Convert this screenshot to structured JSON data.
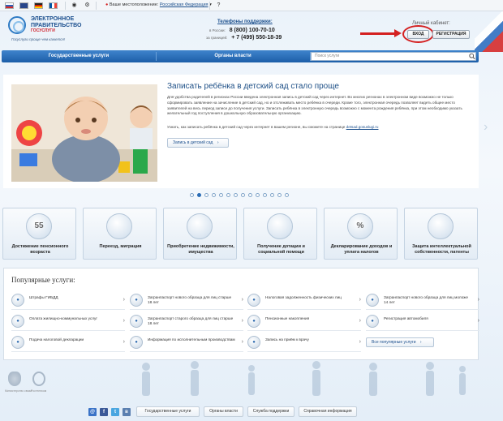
{
  "location": {
    "label": "Ваше местоположение:",
    "city": "Российская Федерация"
  },
  "logo": {
    "line1": "ЭЛЕКТРОННОЕ",
    "line2": "ПРАВИТЕЛЬСТВО",
    "line3": "ГОСУСЛУГИ",
    "slogan": "Госуслуги проще чем кажется!"
  },
  "support": {
    "title": "Телефоны поддержки:",
    "rows": [
      {
        "label": "в России:",
        "number": "8 (800) 100-70-10"
      },
      {
        "label": "за границей:",
        "number": "+ 7 (499) 550-18-39"
      }
    ]
  },
  "cabinet": {
    "title": "Личный кабинет:",
    "login": "ВХОД",
    "register": "РЕГИСТРАЦИЯ"
  },
  "nav": {
    "items": [
      "Государственные услуги",
      "Органы власти"
    ],
    "search_placeholder": "Поиск услуги"
  },
  "banner": {
    "title": "Записать ребёнка в детский сад стало проще",
    "text": "Для удобства родителей в регионах России введена электронная запись в детский сад через интернет. Во многих регионах в электронном виде возможно не только сформировать заявление на зачисление в детский сад, но и отслеживать место ребёнка в очереди. Кроме того, электронная очередь позволяет видеть общее место заявителей на весь период записи до получения услуги. Записать ребёнка в электронную очередь возможно с момента рождения ребёнка, при этом необходимо указать желательный год поступления в дошкольную образовательную организацию.",
    "text2": "Узнать, как записать ребёнка в детский сад через интернет в вашем регионе, вы сможете на странице",
    "link": "detsad.gosuslugi.ru",
    "button": "Запись в детский сад"
  },
  "slider": {
    "count": 14,
    "active": 1
  },
  "tiles": [
    {
      "icon_text": "55",
      "icon": "pension-icon",
      "label": "Достижение пенсионного возраста"
    },
    {
      "icon_text": "",
      "icon": "passport-icon",
      "label": "Переезд, миграция"
    },
    {
      "icon_text": "",
      "icon": "house-icon",
      "label": "Приобретение недвижимости, имущества"
    },
    {
      "icon_text": "",
      "icon": "lifebuoy-icon",
      "label": "Получение дотации и социальной помощи"
    },
    {
      "icon_text": "%",
      "icon": "percent-icon",
      "label": "Декларирование доходов и уплата налогов"
    },
    {
      "icon_text": "",
      "icon": "certificate-icon",
      "label": "Защита интеллектуальной собственности, патенты"
    }
  ],
  "popular": {
    "title": "Популярные услуги:",
    "items": [
      {
        "label": "Штрафы ГИБДД",
        "icon": "traffic-light-icon"
      },
      {
        "label": "Загранпаспорт нового образца для лиц старше 18 лет",
        "icon": "passport-icon"
      },
      {
        "label": "Налоговая задолженность физических лиц",
        "icon": "tax-icon"
      },
      {
        "label": "Загранпаспорт нового образца для лиц моложе 14 лет",
        "icon": "passport-child-icon"
      },
      {
        "label": "Оплата жилищно-коммунальных услуг",
        "icon": "utilities-icon"
      },
      {
        "label": "Загранпаспорт старого образца для лиц старше 18 лет",
        "icon": "passport-old-icon"
      },
      {
        "label": "Пенсионные накопления",
        "icon": "pension-savings-icon"
      },
      {
        "label": "Регистрация автомобиля",
        "icon": "car-icon"
      },
      {
        "label": "Подача налоговой декларации",
        "icon": "declaration-icon"
      },
      {
        "label": "Информация по исполнительным производствам",
        "icon": "info-icon"
      },
      {
        "label": "Запись на приём к врачу",
        "icon": "doctor-icon"
      }
    ],
    "all_button": "Все популярные услуги"
  },
  "footer": {
    "caption1": "Министерство связи",
    "caption2": "Ростелеком",
    "links": [
      "Государственные услуги",
      "Органы власти",
      "Служба поддержки",
      "Справочная информация"
    ]
  },
  "colors": {
    "primary": "#1d5ea8",
    "accent_red": "#d42020"
  }
}
